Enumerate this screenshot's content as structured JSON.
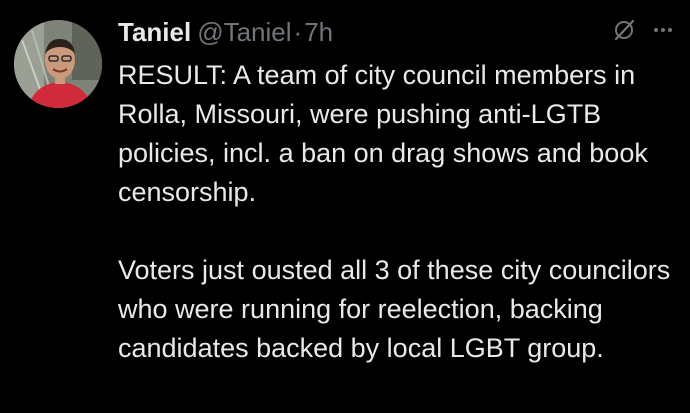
{
  "author": {
    "display_name": "Taniel",
    "handle": "@Taniel",
    "separator": "·",
    "time": "7h",
    "avatar_icon": "profile-photo"
  },
  "header_icons": [
    "grok-icon",
    "more-options-icon"
  ],
  "colors": {
    "background": "#000000",
    "text_primary": "#e7e9ea",
    "text_secondary": "#71767b"
  },
  "tweet": {
    "paragraphs": [
      "RESULT: A team of city council members in Rolla, Missouri, were pushing anti-LGTB policies, incl. a ban on drag shows and book censorship.",
      "Voters just ousted all 3 of these city councilors who were running for reelection, backing candidates backed by local LGBT group."
    ]
  }
}
